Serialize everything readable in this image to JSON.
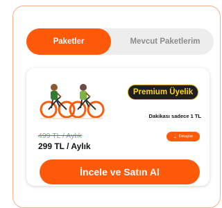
{
  "tabs": {
    "active_label": "Paketler",
    "other_label": "Mevcut Paketlerim"
  },
  "package": {
    "badge_label": "Premium Üyelik",
    "minute_note": "Dakikası sadece 1 TL",
    "old_price": "499 TL / Aylık",
    "new_price": "299 TL / Aylık",
    "details_label": "Detaylar"
  },
  "cta_label": "İncele ve Satın Al",
  "colors": {
    "accent": "#ff5a0a",
    "badge_bg": "#1f1f1f",
    "badge_text": "#ffd11a"
  },
  "icons": {
    "illustration": "two-cyclists-illustration",
    "details": "chevron-down-icon"
  }
}
